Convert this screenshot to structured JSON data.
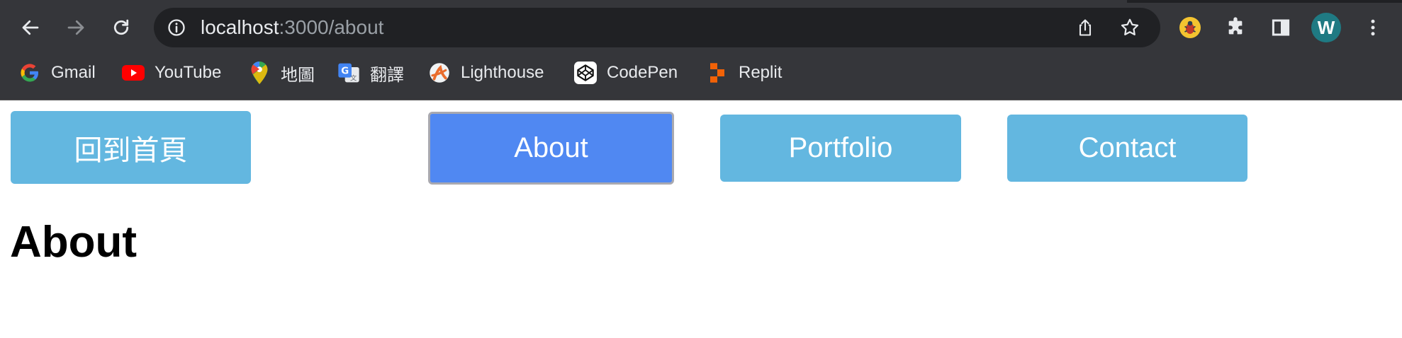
{
  "browser": {
    "url_host": "localhost",
    "url_rest": ":3000/about",
    "profile_initial": "W"
  },
  "bookmarks": [
    {
      "label": "Gmail",
      "icon": "google-icon"
    },
    {
      "label": "YouTube",
      "icon": "youtube-icon"
    },
    {
      "label": "地圖",
      "icon": "maps-pin-icon"
    },
    {
      "label": "翻譯",
      "icon": "translate-icon"
    },
    {
      "label": "Lighthouse",
      "icon": "lighthouse-icon"
    },
    {
      "label": "CodePen",
      "icon": "codepen-icon"
    },
    {
      "label": "Replit",
      "icon": "replit-icon"
    }
  ],
  "page": {
    "nav": {
      "home_label": "回到首頁",
      "about_label": "About",
      "portfolio_label": "Portfolio",
      "contact_label": "Contact",
      "active": "About"
    },
    "heading": "About"
  },
  "colors": {
    "chrome_bg": "#35363a",
    "omnibox_bg": "#202124",
    "nav_button": "#63b7e0",
    "nav_button_active": "#5088f2",
    "avatar_bg": "#1f7a83"
  }
}
